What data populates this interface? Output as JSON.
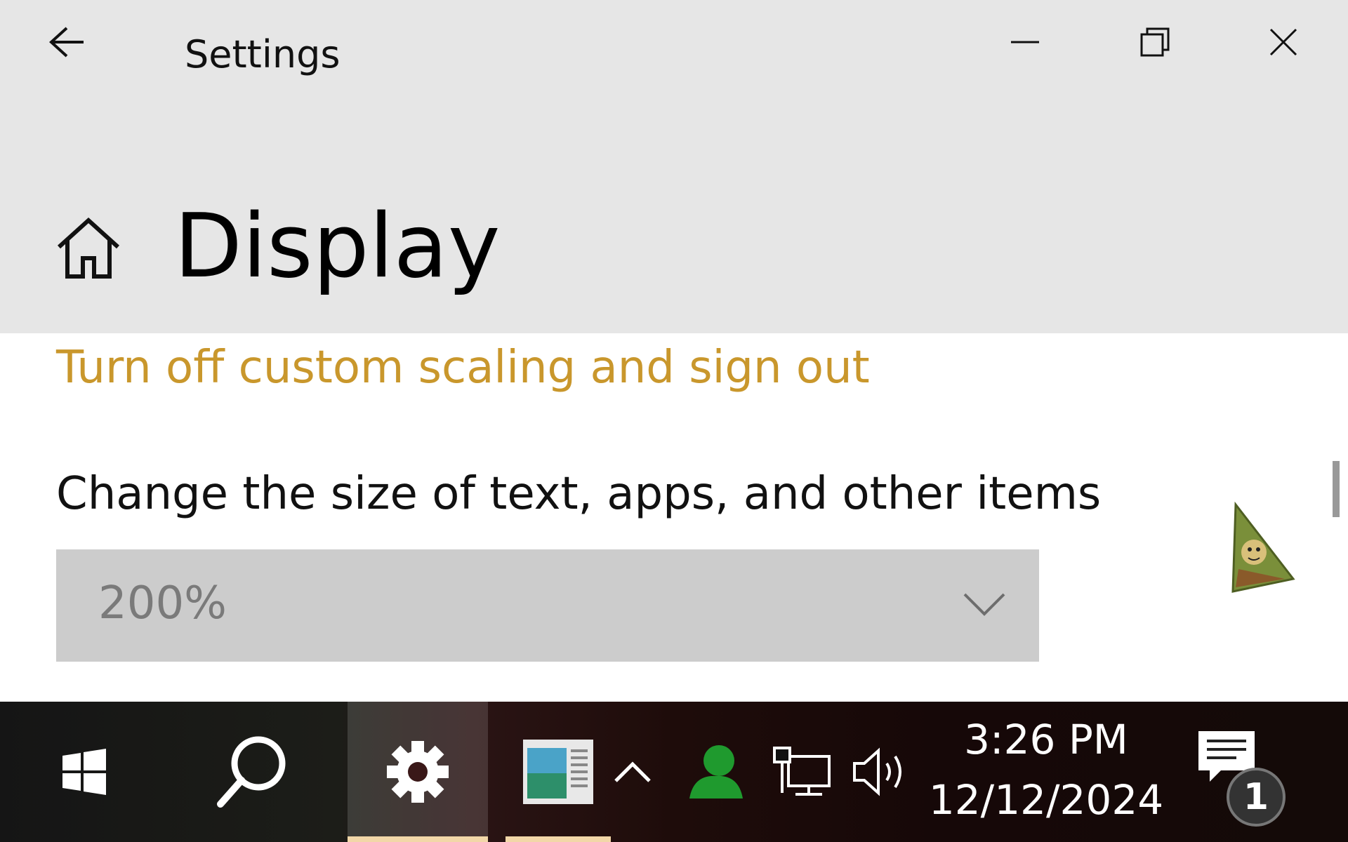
{
  "window": {
    "title": "Settings",
    "controls": [
      "minimize",
      "restore",
      "close"
    ]
  },
  "header": {
    "page_title": "Display"
  },
  "content": {
    "scaling_link": "Turn off custom scaling and sign out",
    "size_label": "Change the size of text, apps, and other items",
    "size_dropdown": {
      "value": "200%"
    }
  },
  "taskbar": {
    "items": [
      "start-icon",
      "search-icon",
      "gear-icon",
      "app-window-icon"
    ],
    "tray_icons": [
      "chevron-up-icon",
      "user-icon",
      "network-icon",
      "volume-icon"
    ],
    "clock": {
      "time": "3:26 PM",
      "date": "12/12/2024"
    },
    "notifications": {
      "count": "1"
    }
  },
  "colors": {
    "titlebar_bg": "#e6e6e6",
    "link_accent": "#c9972c",
    "dropdown_bg": "#cccccc"
  }
}
